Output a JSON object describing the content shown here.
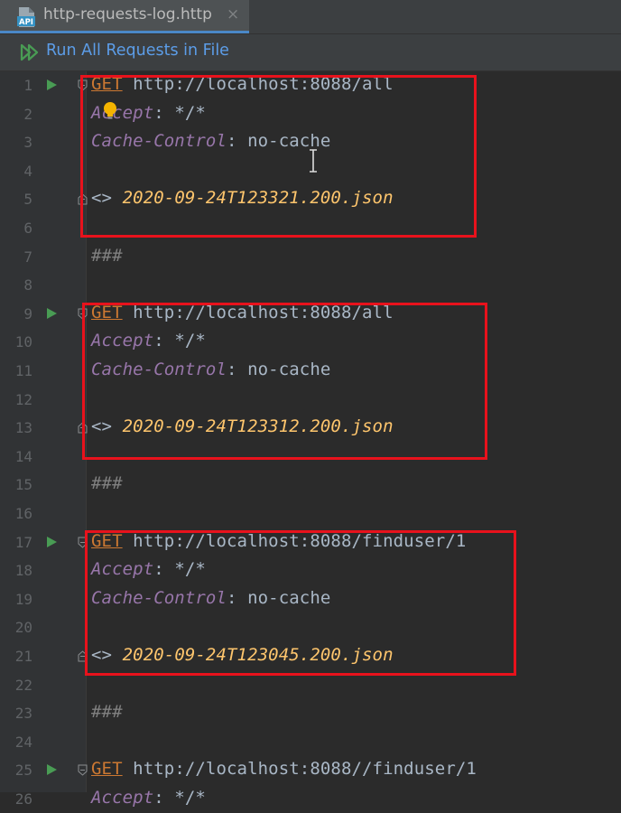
{
  "tab": {
    "title": "http-requests-log.http",
    "close": "×",
    "icon": "api-file-icon"
  },
  "toolbar": {
    "run_all_label": "Run All Requests in File"
  },
  "colors": {
    "get": "#cc7832",
    "header_name": "#9876aa",
    "file": "#ffc66d",
    "run": "#499c54",
    "highlight": "#e8121c",
    "link": "#5c9de8"
  },
  "lines": [
    {
      "n": "1",
      "run": true,
      "fold": "open",
      "method": "GET",
      "url": " http://localhost:8088/all"
    },
    {
      "n": "2",
      "hname": "Accept",
      "colon": ": ",
      "hval": "*/*"
    },
    {
      "n": "3",
      "hname": "Cache-Control",
      "colon": ": ",
      "hval": "no-cache"
    },
    {
      "n": "4"
    },
    {
      "n": "5",
      "fold": "close",
      "redir": "<> ",
      "file": "2020-09-24T123321.200.json"
    },
    {
      "n": "6"
    },
    {
      "n": "7",
      "sep": "###"
    },
    {
      "n": "8"
    },
    {
      "n": "9",
      "run": true,
      "fold": "open",
      "method": "GET",
      "url": " http://localhost:8088/all"
    },
    {
      "n": "10",
      "hname": "Accept",
      "colon": ": ",
      "hval": "*/*"
    },
    {
      "n": "11",
      "hname": "Cache-Control",
      "colon": ": ",
      "hval": "no-cache"
    },
    {
      "n": "12"
    },
    {
      "n": "13",
      "fold": "close",
      "redir": "<> ",
      "file": "2020-09-24T123312.200.json"
    },
    {
      "n": "14"
    },
    {
      "n": "15",
      "sep": "###"
    },
    {
      "n": "16"
    },
    {
      "n": "17",
      "run": true,
      "fold": "open",
      "method": "GET",
      "url": " http://localhost:8088/finduser/1"
    },
    {
      "n": "18",
      "hname": "Accept",
      "colon": ": ",
      "hval": "*/*"
    },
    {
      "n": "19",
      "hname": "Cache-Control",
      "colon": ": ",
      "hval": "no-cache"
    },
    {
      "n": "20"
    },
    {
      "n": "21",
      "fold": "close",
      "redir": "<> ",
      "file": "2020-09-24T123045.200.json"
    },
    {
      "n": "22"
    },
    {
      "n": "23",
      "sep": "###"
    },
    {
      "n": "24"
    },
    {
      "n": "25",
      "run": true,
      "fold": "open",
      "method": "GET",
      "url": " http://localhost:8088//finduser/1"
    },
    {
      "n": "26",
      "hname": "Accept",
      "colon": ": ",
      "hval": "*/*"
    }
  ]
}
